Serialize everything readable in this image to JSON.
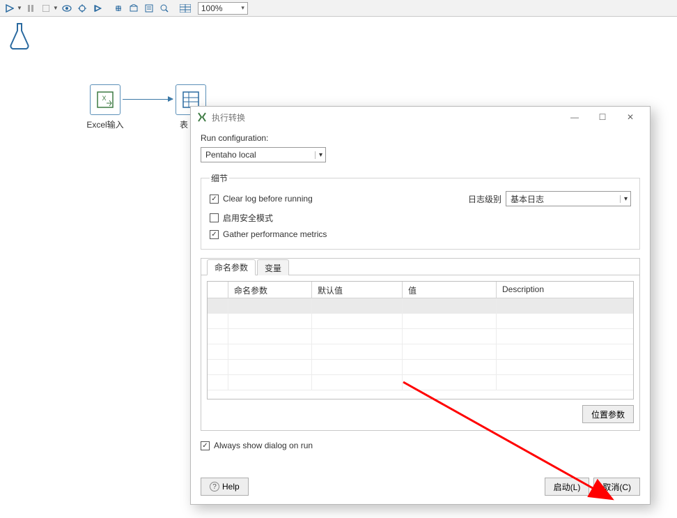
{
  "toolbar": {
    "zoom": "100%"
  },
  "canvas": {
    "node1_label": "Excel输入",
    "node2_label": "表"
  },
  "dialog": {
    "title": "执行转换",
    "run_config_label": "Run configuration:",
    "run_config_value": "Pentaho local",
    "details_legend": "细节",
    "clear_log_label": "Clear log before running",
    "safe_mode_label": "启用安全模式",
    "gather_metrics_label": "Gather performance metrics",
    "log_level_label": "日志级别",
    "log_level_value": "基本日志",
    "tabs": {
      "params": "命名参数",
      "vars": "变量"
    },
    "table": {
      "col_name": "命名参数",
      "col_default": "默认值",
      "col_value": "值",
      "col_desc": "Description"
    },
    "pos_params_btn": "位置参数",
    "always_show_label": "Always show dialog on run",
    "help_btn": "Help",
    "launch_btn": "启动(L)",
    "cancel_btn": "取消(C)"
  }
}
